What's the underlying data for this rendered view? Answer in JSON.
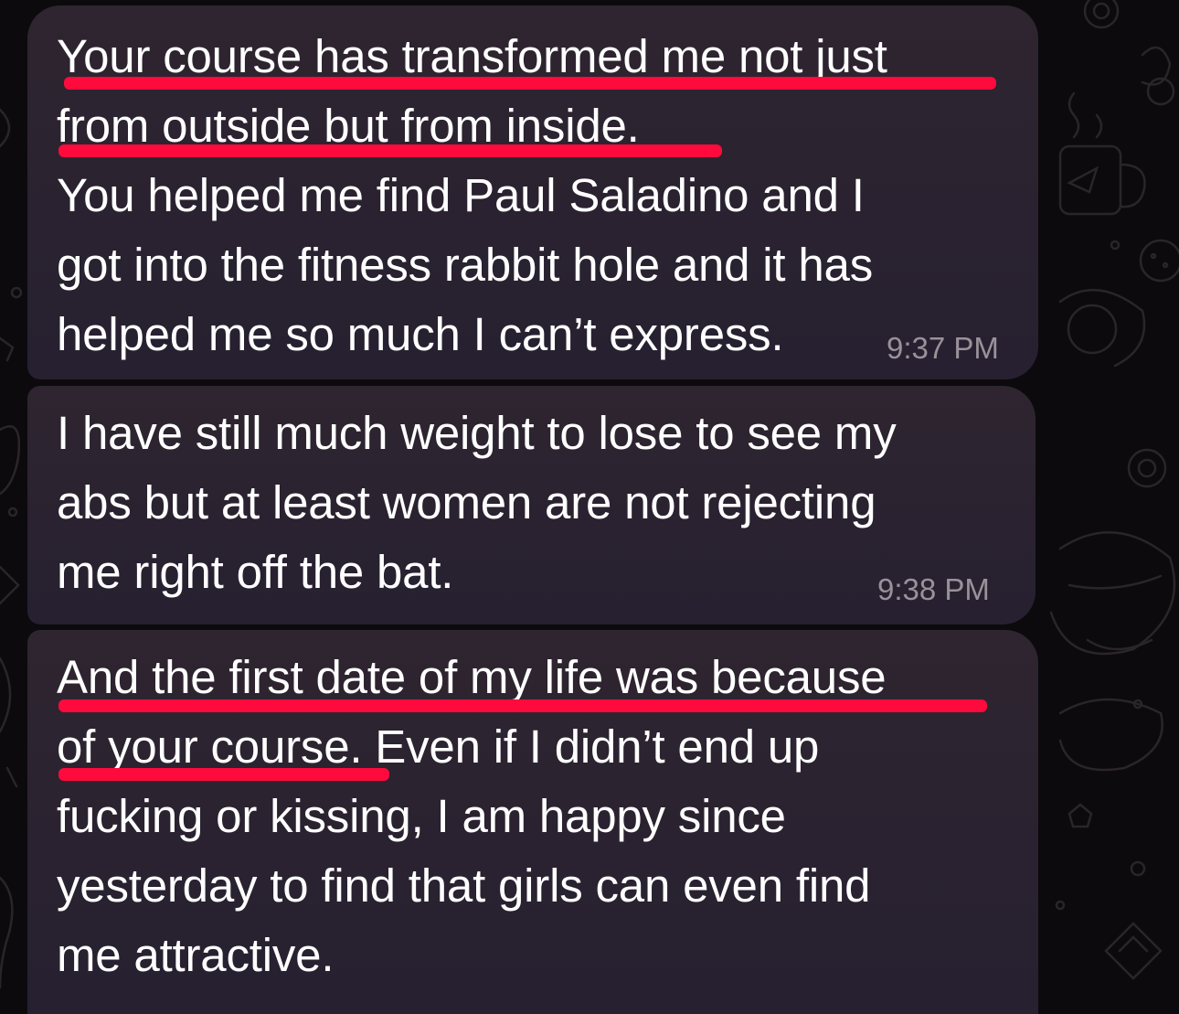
{
  "messages": [
    {
      "lines": [
        "Your course has transformed me not just",
        "from outside but from inside.",
        "You helped me find Paul Saladino and I",
        "got into the fitness rabbit hole and it has",
        "helped me so much I can’t express."
      ],
      "time": "9:37 PM"
    },
    {
      "lines": [
        "I have still much weight to lose to see my",
        "abs but at least women are not rejecting",
        "me right off the bat."
      ],
      "time": "9:38 PM"
    },
    {
      "lines": [
        "And the first date of my life was because",
        "of your course",
        ". Even if I didn’t end up",
        "fucking or kissing, I am happy since",
        "yesterday to find that girls can even find",
        "me attractive."
      ]
    }
  ],
  "colors": {
    "bubble": "#2c2430",
    "underline": "#ff0a3c",
    "timestamp": "#9a9199",
    "text": "#ffffff"
  }
}
